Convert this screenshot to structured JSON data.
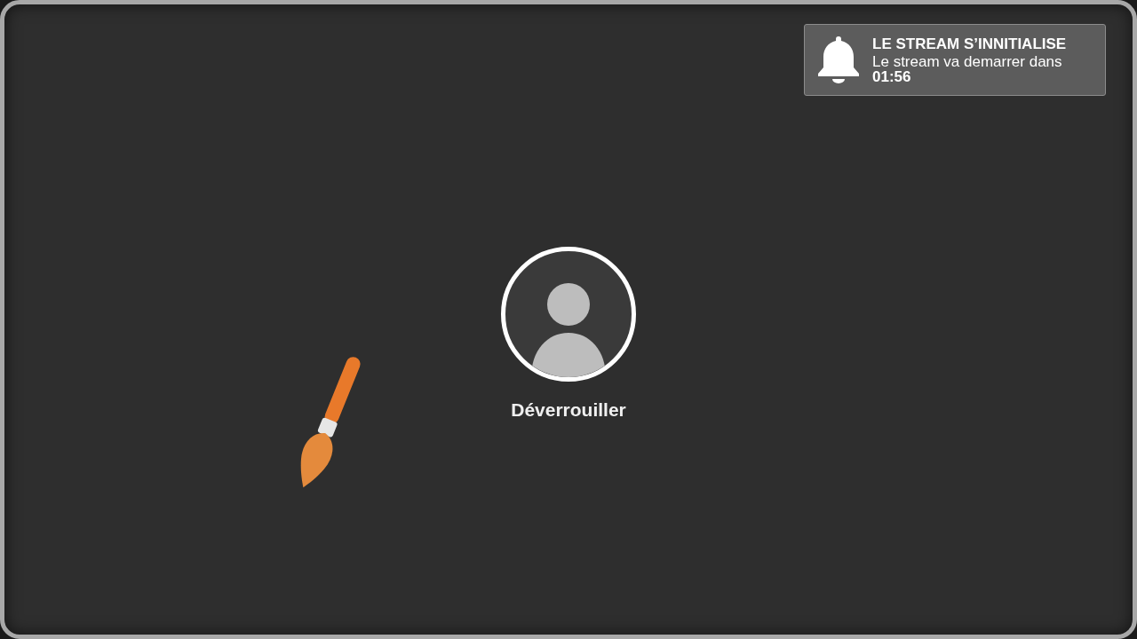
{
  "notification": {
    "title": "LE STREAM S’INNITIALISE",
    "message": "Le stream va demarrer dans **01:56**"
  },
  "lock": {
    "label": "Déverrouiller"
  }
}
